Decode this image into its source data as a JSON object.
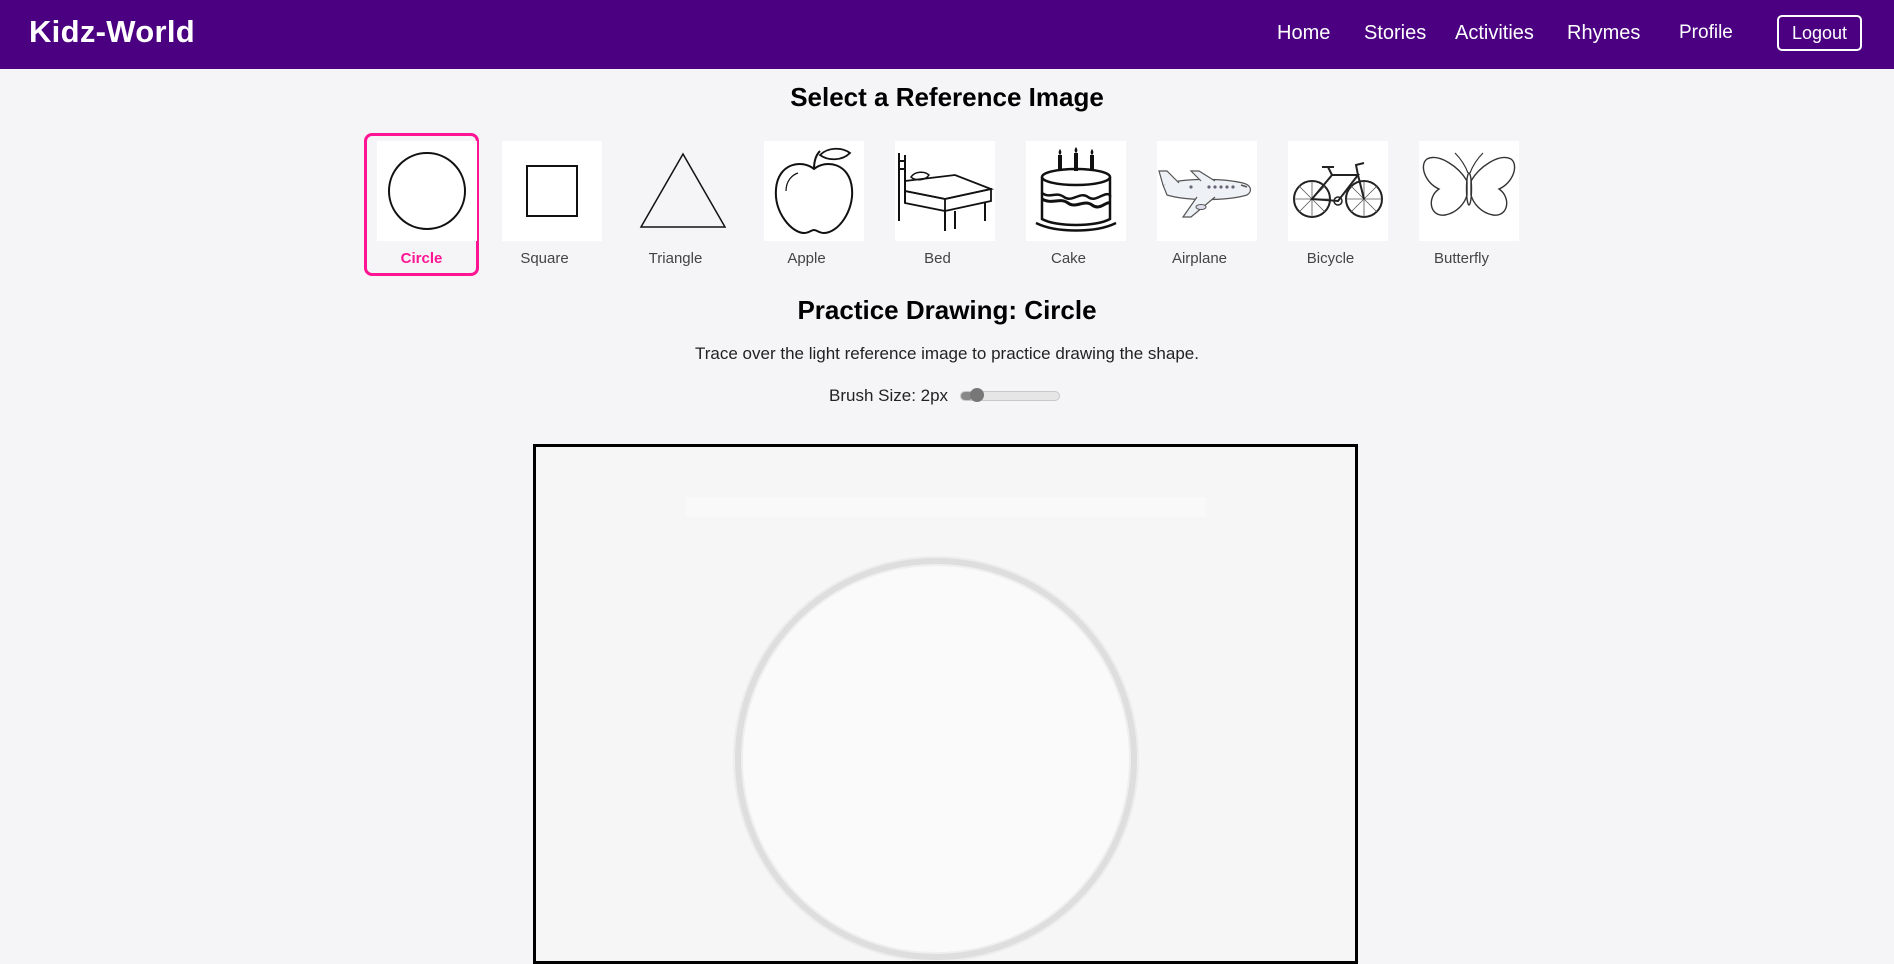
{
  "navbar": {
    "brand": "Kidz-World",
    "links": [
      "Home",
      "Stories",
      "Activities",
      "Rhymes",
      "Profile"
    ],
    "logout_label": "Logout",
    "background": "#4b0082"
  },
  "reference": {
    "title": "Select a Reference Image",
    "selected": "Circle",
    "accent": "#ff1493",
    "items": [
      {
        "label": "Circle",
        "icon": "circle-icon"
      },
      {
        "label": "Square",
        "icon": "square-icon"
      },
      {
        "label": "Triangle",
        "icon": "triangle-icon"
      },
      {
        "label": "Apple",
        "icon": "apple-icon"
      },
      {
        "label": "Bed",
        "icon": "bed-icon"
      },
      {
        "label": "Cake",
        "icon": "cake-icon"
      },
      {
        "label": "Airplane",
        "icon": "airplane-icon"
      },
      {
        "label": "Bicycle",
        "icon": "bicycle-icon"
      },
      {
        "label": "Butterfly",
        "icon": "butterfly-icon"
      }
    ]
  },
  "practice": {
    "title": "Practice Drawing: Circle",
    "instruction": "Trace over the light reference image to practice drawing the shape.",
    "brush_label": "Brush Size: 2px",
    "brush_level": 0.12
  }
}
